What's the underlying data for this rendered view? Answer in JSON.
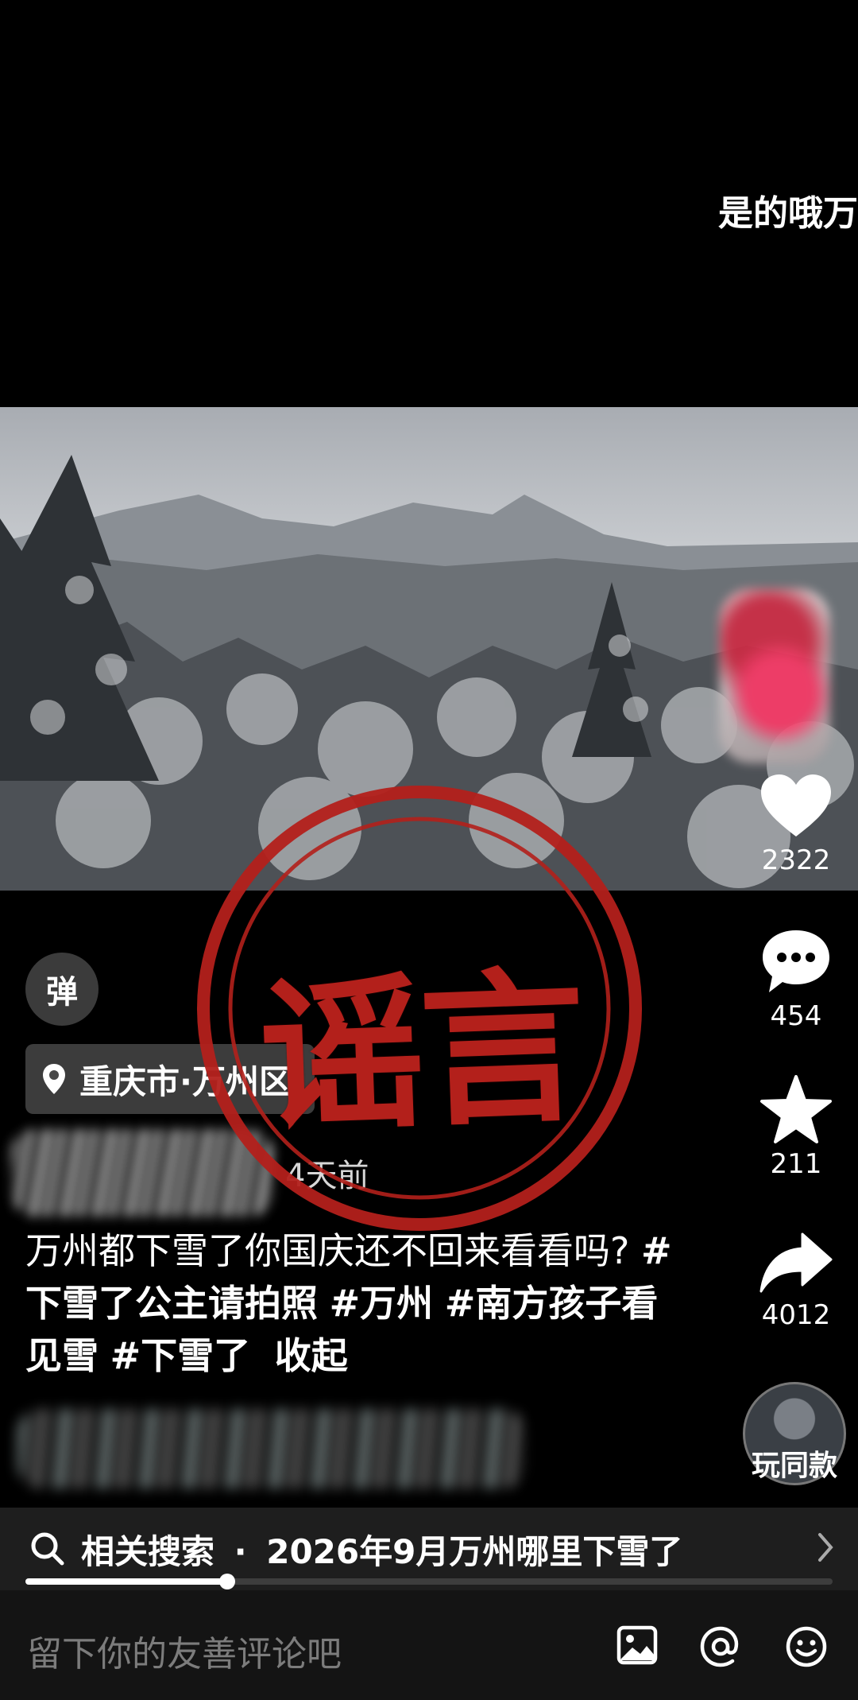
{
  "top_caption": "是的哦万",
  "stamp": {
    "text": "谣言",
    "color": "#b3201b"
  },
  "actions": {
    "like_count": "2322",
    "comment_count": "454",
    "favorite_count": "211",
    "share_count": "4012",
    "remix_label": "玩同款"
  },
  "danmu_button": "弹",
  "location": "重庆市·万州区",
  "post": {
    "time_ago": "4天前",
    "description_text": "万州都下雪了你国庆还不回来看看吗?",
    "hashtags": [
      "#下雪了公主请拍照",
      "#万州",
      "#南方孩子看见雪",
      "#下雪了"
    ],
    "collapse_label": "收起"
  },
  "related_search": {
    "prefix": "相关搜索",
    "separator": "·",
    "query": "2026年9月万州哪里下雪了",
    "progress_fraction": 0.25
  },
  "comment_bar": {
    "placeholder": "留下你的友善评论吧"
  },
  "icons": [
    "heart-icon",
    "comment-icon",
    "star-icon",
    "share-icon",
    "location-pin-icon",
    "search-icon",
    "chevron-right-icon",
    "image-icon",
    "at-icon",
    "emoji-icon"
  ]
}
